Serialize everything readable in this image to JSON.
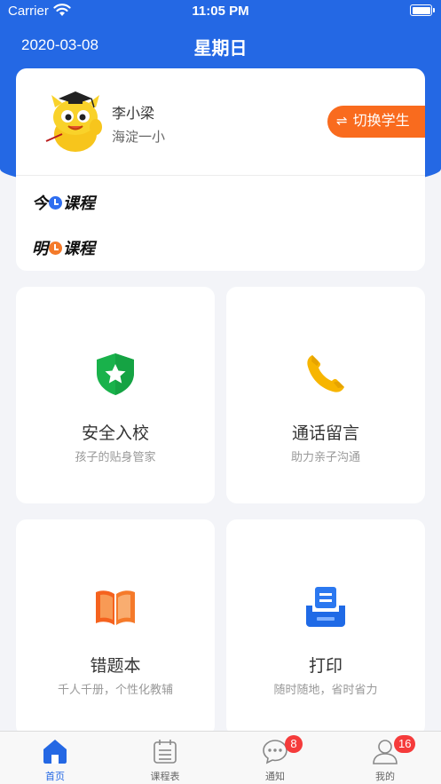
{
  "status_bar": {
    "carrier": "Carrier",
    "time": "11:05 PM"
  },
  "header": {
    "date": "2020-03-08",
    "weekday": "星期日"
  },
  "profile": {
    "student_name": "李小梁",
    "school": "海淀一小",
    "switch_label": "切换学生",
    "switch_icon": "swap-arrows-icon"
  },
  "schedule": {
    "today_prefix": "今",
    "today_suffix": "课程",
    "tomorrow_prefix": "明",
    "tomorrow_suffix": "课程"
  },
  "features": [
    {
      "title": "安全入校",
      "subtitle": "孩子的贴身管家",
      "icon": "shield-star-icon",
      "color": "#19b24b"
    },
    {
      "title": "通话留言",
      "subtitle": "助力亲子沟通",
      "icon": "phone-icon",
      "color": "#f7b500"
    },
    {
      "title": "错题本",
      "subtitle": "千人千册，个性化教辅",
      "icon": "book-icon",
      "color": "#f5621e"
    },
    {
      "title": "打印",
      "subtitle": "随时随地，省时省力",
      "icon": "printer-icon",
      "color": "#2b78f0"
    }
  ],
  "tabs": [
    {
      "label": "首页",
      "icon": "home-icon",
      "active": true
    },
    {
      "label": "课程表",
      "icon": "calendar-icon",
      "active": false
    },
    {
      "label": "通知",
      "icon": "message-icon",
      "active": false,
      "badge": "8"
    },
    {
      "label": "我的",
      "icon": "user-icon",
      "active": false,
      "badge": "16"
    }
  ],
  "colors": {
    "brand_blue": "#2468e4",
    "accent_orange": "#f96b1e",
    "badge_red": "#f53b3b"
  }
}
